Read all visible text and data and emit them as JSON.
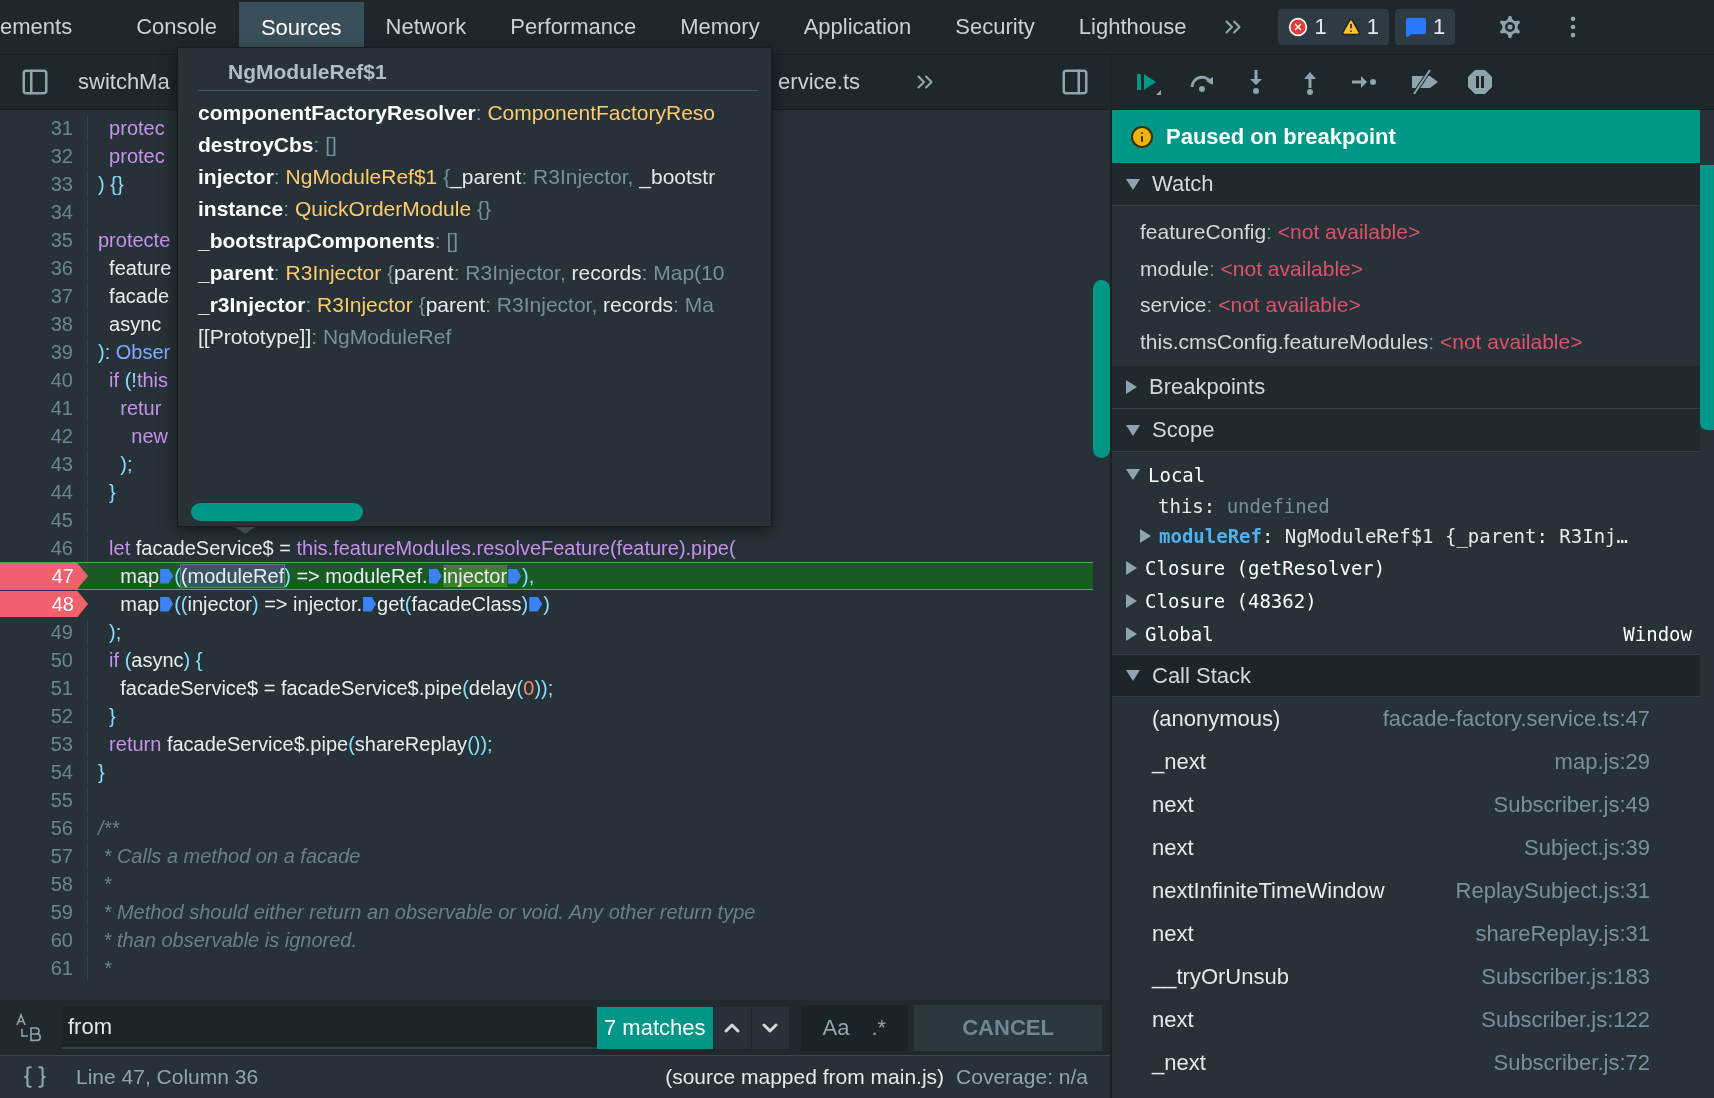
{
  "tabs": [
    {
      "label": "ements",
      "selected": false
    },
    {
      "label": "Console",
      "selected": false
    },
    {
      "label": "Sources",
      "selected": true
    },
    {
      "label": "Network",
      "selected": false
    },
    {
      "label": "Performance",
      "selected": false
    },
    {
      "label": "Memory",
      "selected": false
    },
    {
      "label": "Application",
      "selected": false
    },
    {
      "label": "Security",
      "selected": false
    },
    {
      "label": "Lighthouse",
      "selected": false
    }
  ],
  "counters": {
    "errors": "1",
    "warnings": "1",
    "issues": "1"
  },
  "file_tabs": [
    "switchMa",
    "ervice.ts"
  ],
  "code_lines": [
    {
      "number": "31",
      "breakpoint": false,
      "current": false,
      "tokens": [
        {
          "kind": "keyword",
          "text": "  protec"
        }
      ]
    },
    {
      "number": "32",
      "breakpoint": false,
      "current": false,
      "tokens": [
        {
          "kind": "keyword",
          "text": "  protec"
        }
      ]
    },
    {
      "number": "33",
      "breakpoint": false,
      "current": false,
      "tokens": [
        {
          "kind": "punct",
          "text": ") {}"
        }
      ]
    },
    {
      "number": "34",
      "breakpoint": false,
      "current": false
    },
    {
      "number": "35",
      "breakpoint": false,
      "current": false,
      "tokens": [
        {
          "kind": "keyword",
          "text": "protecte"
        }
      ]
    },
    {
      "number": "36",
      "breakpoint": false,
      "current": false,
      "tokens": [
        {
          "kind": "plain",
          "text": "  feature"
        }
      ]
    },
    {
      "number": "37",
      "breakpoint": false,
      "current": false,
      "tokens": [
        {
          "kind": "plain",
          "text": "  facade"
        }
      ]
    },
    {
      "number": "38",
      "breakpoint": false,
      "current": false,
      "tokens": [
        {
          "kind": "plain",
          "text": "  async"
        }
      ]
    },
    {
      "number": "39",
      "breakpoint": false,
      "current": false,
      "tokens": [
        {
          "kind": "punct",
          "text": "): "
        },
        {
          "kind": "type",
          "text": "Obser"
        }
      ]
    },
    {
      "number": "40",
      "breakpoint": false,
      "current": false,
      "tokens": [
        {
          "kind": "keyword",
          "text": "  if "
        },
        {
          "kind": "punct",
          "text": "(!"
        },
        {
          "kind": "keyword",
          "text": "this"
        }
      ]
    },
    {
      "number": "41",
      "breakpoint": false,
      "current": false,
      "tokens": [
        {
          "kind": "keyword",
          "text": "    retur"
        }
      ]
    },
    {
      "number": "42",
      "breakpoint": false,
      "current": false,
      "tokens": [
        {
          "kind": "keyword",
          "text": "      new"
        }
      ]
    },
    {
      "number": "43",
      "breakpoint": false,
      "current": false,
      "tokens": [
        {
          "kind": "punct",
          "text": "    );"
        }
      ]
    },
    {
      "number": "44",
      "breakpoint": false,
      "current": false,
      "tokens": [
        {
          "kind": "punct",
          "text": "  }"
        }
      ]
    },
    {
      "number": "45",
      "breakpoint": false,
      "current": false
    },
    {
      "number": "46",
      "breakpoint": false,
      "current": false,
      "tokens": [
        {
          "kind": "keyword",
          "text": "  let "
        },
        {
          "kind": "plain",
          "text": "facadeService$ = "
        },
        {
          "kind": "keyword",
          "text": "this.featureModules.resolveFeature(feature).pipe("
        }
      ]
    },
    {
      "number": "47",
      "breakpoint": true,
      "current": true,
      "tokens": [
        {
          "kind": "plain",
          "text": "    map"
        },
        {
          "kind": "marker"
        },
        {
          "kind": "punct",
          "text": "("
        },
        {
          "kind": "match",
          "text": "(moduleRef"
        },
        {
          "kind": "punct",
          "text": ")"
        },
        {
          "kind": "plain",
          "text": " => moduleRef."
        },
        {
          "kind": "marker"
        },
        {
          "kind": "exec",
          "text": "injector"
        },
        {
          "kind": "marker"
        },
        {
          "kind": "punct",
          "text": "),"
        }
      ]
    },
    {
      "number": "48",
      "breakpoint": true,
      "current": false,
      "tokens": [
        {
          "kind": "plain",
          "text": "    map"
        },
        {
          "kind": "marker"
        },
        {
          "kind": "punct",
          "text": "(("
        },
        {
          "kind": "plain",
          "text": "injector"
        },
        {
          "kind": "punct",
          "text": ")"
        },
        {
          "kind": "plain",
          "text": " => injector."
        },
        {
          "kind": "marker"
        },
        {
          "kind": "plain",
          "text": "get"
        },
        {
          "kind": "punct",
          "text": "("
        },
        {
          "kind": "plain",
          "text": "facadeClass"
        },
        {
          "kind": "punct",
          "text": ")"
        },
        {
          "kind": "marker"
        },
        {
          "kind": "punct",
          "text": ")"
        }
      ]
    },
    {
      "number": "49",
      "breakpoint": false,
      "current": false,
      "tokens": [
        {
          "kind": "punct",
          "text": "  );"
        }
      ]
    },
    {
      "number": "50",
      "breakpoint": false,
      "current": false,
      "tokens": [
        {
          "kind": "keyword",
          "text": "  if "
        },
        {
          "kind": "punct",
          "text": "("
        },
        {
          "kind": "plain",
          "text": "async"
        },
        {
          "kind": "punct",
          "text": ") {"
        }
      ]
    },
    {
      "number": "51",
      "breakpoint": false,
      "current": false,
      "tokens": [
        {
          "kind": "plain",
          "text": "    facadeService$ = facadeService$.pipe"
        },
        {
          "kind": "punct",
          "text": "("
        },
        {
          "kind": "plain",
          "text": "delay"
        },
        {
          "kind": "punct",
          "text": "("
        },
        {
          "kind": "number",
          "text": "0"
        },
        {
          "kind": "punct",
          "text": "));"
        }
      ]
    },
    {
      "number": "52",
      "breakpoint": false,
      "current": false,
      "tokens": [
        {
          "kind": "punct",
          "text": "  }"
        }
      ]
    },
    {
      "number": "53",
      "breakpoint": false,
      "current": false,
      "tokens": [
        {
          "kind": "keyword",
          "text": "  return "
        },
        {
          "kind": "plain",
          "text": "facadeService$.pipe"
        },
        {
          "kind": "punct",
          "text": "("
        },
        {
          "kind": "plain",
          "text": "shareReplay"
        },
        {
          "kind": "punct",
          "text": "());"
        }
      ]
    },
    {
      "number": "54",
      "breakpoint": false,
      "current": false,
      "tokens": [
        {
          "kind": "punct",
          "text": "}"
        }
      ]
    },
    {
      "number": "55",
      "breakpoint": false,
      "current": false
    },
    {
      "number": "56",
      "breakpoint": false,
      "current": false,
      "tokens": [
        {
          "kind": "comment",
          "text": "/**"
        }
      ]
    },
    {
      "number": "57",
      "breakpoint": false,
      "current": false,
      "tokens": [
        {
          "kind": "comment",
          "text": " * Calls a method on a facade"
        }
      ]
    },
    {
      "number": "58",
      "breakpoint": false,
      "current": false,
      "tokens": [
        {
          "kind": "comment",
          "text": " *"
        }
      ]
    },
    {
      "number": "59",
      "breakpoint": false,
      "current": false,
      "tokens": [
        {
          "kind": "comment",
          "text": " * Method should either return an observable or void. Any other return type"
        }
      ]
    },
    {
      "number": "60",
      "breakpoint": false,
      "current": false,
      "tokens": [
        {
          "kind": "comment",
          "text": " * than observable is ignored."
        }
      ]
    },
    {
      "number": "61",
      "breakpoint": false,
      "current": false,
      "tokens": [
        {
          "kind": "comment",
          "text": " *"
        }
      ]
    }
  ],
  "popover": {
    "title": "NgModuleRef$1",
    "properties": [
      [
        {
          "kind": "name",
          "text": "componentFactoryResolver"
        },
        {
          "kind": "dim",
          "text": ": "
        },
        {
          "kind": "type",
          "text": "ComponentFactoryReso"
        }
      ],
      [
        {
          "kind": "name",
          "text": "destroyCbs"
        },
        {
          "kind": "dim",
          "text": ": []"
        }
      ],
      [
        {
          "kind": "name",
          "text": "injector"
        },
        {
          "kind": "dim",
          "text": ": "
        },
        {
          "kind": "type",
          "text": "NgModuleRef$1"
        },
        {
          "kind": "dim",
          "text": " {"
        },
        {
          "kind": "key",
          "text": "_parent"
        },
        {
          "kind": "dim",
          "text": ": R3Injector, "
        },
        {
          "kind": "key",
          "text": "_bootstr"
        }
      ],
      [
        {
          "kind": "name",
          "text": "instance"
        },
        {
          "kind": "dim",
          "text": ": "
        },
        {
          "kind": "type",
          "text": "QuickOrderModule"
        },
        {
          "kind": "dim",
          "text": " {}"
        }
      ],
      [
        {
          "kind": "name",
          "text": "_bootstrapComponents"
        },
        {
          "kind": "dim",
          "text": ": []"
        }
      ],
      [
        {
          "kind": "name",
          "text": "_parent"
        },
        {
          "kind": "dim",
          "text": ": "
        },
        {
          "kind": "type",
          "text": "R3Injector"
        },
        {
          "kind": "dim",
          "text": " {"
        },
        {
          "kind": "key",
          "text": "parent"
        },
        {
          "kind": "dim",
          "text": ": R3Injector, "
        },
        {
          "kind": "key",
          "text": "records"
        },
        {
          "kind": "dim",
          "text": ": Map(10"
        }
      ],
      [
        {
          "kind": "name",
          "text": "_r3Injector"
        },
        {
          "kind": "dim",
          "text": ": "
        },
        {
          "kind": "type",
          "text": "R3Injector"
        },
        {
          "kind": "dim",
          "text": " {"
        },
        {
          "kind": "key",
          "text": "parent"
        },
        {
          "kind": "dim",
          "text": ": R3Injector, "
        },
        {
          "kind": "key",
          "text": "records"
        },
        {
          "kind": "dim",
          "text": ": Ma"
        }
      ],
      [
        {
          "kind": "key",
          "text": "[[Prototype]]"
        },
        {
          "kind": "dim",
          "text": ": NgModuleRef"
        }
      ]
    ]
  },
  "search": {
    "value": "from",
    "matches": "7 matches",
    "case_label": "Aa",
    "regex_label": ".*",
    "cancel": "CANCEL"
  },
  "status_bar": {
    "position": "Line 47, Column 36",
    "source": "(source mapped from main.js)",
    "coverage": "Coverage: n/a"
  },
  "debugger": {
    "banner": "Paused on breakpoint",
    "watch": {
      "title": "Watch",
      "expanded": true,
      "items": [
        [
          {
            "kind": "name",
            "text": "featureConfig"
          },
          {
            "kind": "dim",
            "text": ": "
          },
          {
            "kind": "error",
            "text": "<not available>"
          }
        ],
        [
          {
            "kind": "name",
            "text": "module"
          },
          {
            "kind": "dim",
            "text": ": "
          },
          {
            "kind": "error",
            "text": "<not available>"
          }
        ],
        [
          {
            "kind": "name",
            "text": "service"
          },
          {
            "kind": "dim",
            "text": ": "
          },
          {
            "kind": "error",
            "text": "<not available>"
          }
        ],
        [
          {
            "kind": "name",
            "text": "this.cmsConfig.featureModules"
          },
          {
            "kind": "dim",
            "text": ": "
          },
          {
            "kind": "error",
            "text": "<not available>"
          }
        ]
      ]
    },
    "breakpoints": {
      "title": "Breakpoints",
      "expanded": false
    },
    "scope": {
      "title": "Scope",
      "expanded": true,
      "items": [
        {
          "label": "Local",
          "expanded": true,
          "children": [
            {
              "expandable": false,
              "segments": [
                {
                  "kind": "plain",
                  "text": "this: "
                },
                {
                  "kind": "dim",
                  "text": "undefined"
                }
              ]
            },
            {
              "expandable": true,
              "segments": [
                {
                  "kind": "prop",
                  "text": "moduleRef"
                },
                {
                  "kind": "plain",
                  "text": ": NgModuleRef$1 {_parent: R3Inj…"
                }
              ]
            }
          ]
        },
        {
          "label": "Closure (getResolver)",
          "expanded": false
        },
        {
          "label": "Closure (48362)",
          "expanded": false
        },
        {
          "label": "Global",
          "expanded": false,
          "value": "Window"
        }
      ]
    },
    "call_stack": {
      "title": "Call Stack",
      "expanded": true,
      "frames": [
        {
          "function": "(anonymous)",
          "location": "facade-factory.service.ts:47"
        },
        {
          "function": "_next",
          "location": "map.js:29"
        },
        {
          "function": "next",
          "location": "Subscriber.js:49"
        },
        {
          "function": "next",
          "location": "Subject.js:39"
        },
        {
          "function": "nextInfiniteTimeWindow",
          "location": "ReplaySubject.js:31"
        },
        {
          "function": "next",
          "location": "shareReplay.js:31"
        },
        {
          "function": "__tryOrUnsub",
          "location": "Subscriber.js:183"
        },
        {
          "function": "next",
          "location": "Subscriber.js:122"
        },
        {
          "function": "_next",
          "location": "Subscriber.js:72"
        }
      ]
    }
  }
}
